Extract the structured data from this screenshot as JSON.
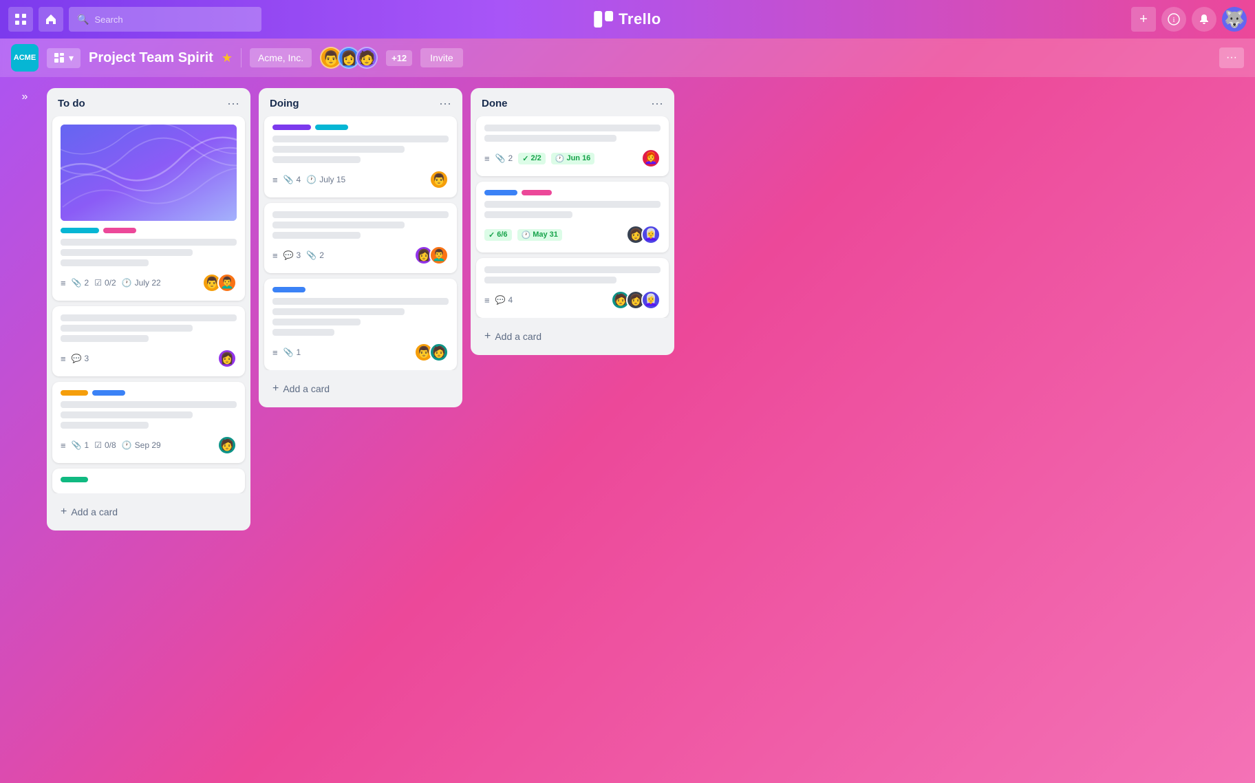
{
  "app": {
    "name": "Trello",
    "logo_text": "Trello"
  },
  "nav": {
    "search_placeholder": "Search",
    "grid_icon": "⊞",
    "home_icon": "🏠",
    "search_icon": "🔍",
    "add_icon": "+",
    "info_icon": "ⓘ",
    "bell_icon": "🔔",
    "avatar_icon": "🐺"
  },
  "board": {
    "workspace_abbr": "ACME",
    "board_type_icon": "▦",
    "title": "Project Team Spirit",
    "star_icon": "★",
    "workspace_name": "Acme, Inc.",
    "member_count": "+12",
    "invite_label": "Invite",
    "more_icon": "···"
  },
  "lists": [
    {
      "id": "todo",
      "title": "To do",
      "more_icon": "···",
      "cards": [
        {
          "id": "card-1",
          "has_cover": true,
          "tags": [
            "cyan",
            "pink"
          ],
          "text_lines": [
            "full",
            "med",
            "short"
          ],
          "meta_icon": true,
          "attachments": "2",
          "checklist": "0/2",
          "date": "July 22",
          "avatars": [
            "yellow",
            "orange"
          ]
        },
        {
          "id": "card-2",
          "has_cover": false,
          "tags": [],
          "text_lines": [
            "full",
            "med",
            "short"
          ],
          "meta_comments": "3",
          "avatars": [
            "purple"
          ]
        },
        {
          "id": "card-3",
          "has_cover": false,
          "tags": [
            "yellow",
            "blue"
          ],
          "text_lines": [
            "full",
            "med",
            "short"
          ],
          "meta_icon": true,
          "attachments": "1",
          "checklist": "0/8",
          "date": "Sep 29",
          "avatars": [
            "teal"
          ]
        },
        {
          "id": "card-4",
          "has_cover": false,
          "tags": [
            "green"
          ],
          "text_lines": [
            "full"
          ],
          "avatars": []
        }
      ],
      "add_card_label": "+ Add a card"
    },
    {
      "id": "doing",
      "title": "Doing",
      "more_icon": "···",
      "cards": [
        {
          "id": "card-5",
          "has_cover": false,
          "tags": [
            "purple",
            "cyan"
          ],
          "text_lines": [
            "full",
            "med",
            "short"
          ],
          "meta_icon": true,
          "attachments": "4",
          "date": "July 15",
          "avatars": [
            "yellow"
          ]
        },
        {
          "id": "card-6",
          "has_cover": false,
          "tags": [],
          "text_lines": [
            "full",
            "med",
            "short"
          ],
          "meta_comments": "3",
          "meta_attachments": "2",
          "avatars": [
            "purple",
            "orange"
          ]
        },
        {
          "id": "card-7",
          "has_cover": false,
          "tags": [
            "blue"
          ],
          "text_lines": [
            "full",
            "med",
            "short",
            "xshort"
          ],
          "meta_icon": true,
          "attachments": "1",
          "avatars": [
            "yellow",
            "teal"
          ]
        }
      ],
      "add_card_label": "+ Add a card"
    },
    {
      "id": "done",
      "title": "Done",
      "more_icon": "···",
      "cards": [
        {
          "id": "card-8",
          "has_cover": false,
          "tags": [],
          "text_lines": [
            "full",
            "med"
          ],
          "meta_icon": true,
          "attachments": "2",
          "checklist_badge": "2/2",
          "date_badge": "Jun 16",
          "avatars": [
            "rose"
          ]
        },
        {
          "id": "card-9",
          "has_cover": false,
          "tags": [
            "blue",
            "pink"
          ],
          "text_lines": [
            "full",
            "short"
          ],
          "checklist_badge": "6/6",
          "date_badge": "May 31",
          "avatars": [
            "dark",
            "indigo"
          ]
        },
        {
          "id": "card-10",
          "has_cover": false,
          "tags": [],
          "text_lines": [
            "full",
            "med"
          ],
          "meta_icon": true,
          "comments": "4",
          "avatars": [
            "teal",
            "dark",
            "indigo"
          ]
        }
      ],
      "add_card_label": "+ Add a card"
    }
  ]
}
